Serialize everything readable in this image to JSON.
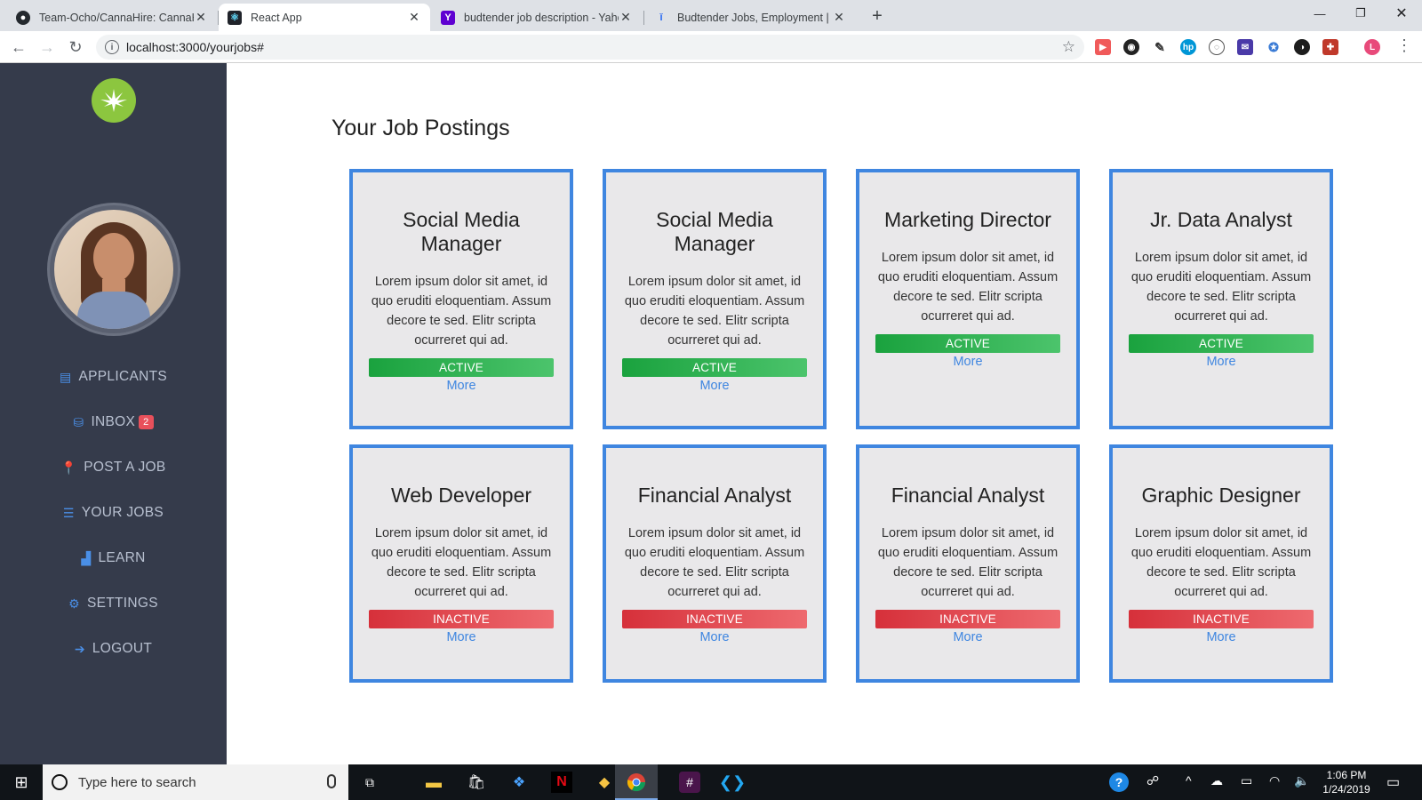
{
  "browser": {
    "tabs": [
      {
        "title": "Team-Ocho/CannaHire: CannaHire",
        "icon": "github-icon",
        "active": false
      },
      {
        "title": "React App",
        "icon": "react-icon",
        "active": true
      },
      {
        "title": "budtender job description - Yahoo",
        "icon": "yahoo-icon",
        "active": false
      },
      {
        "title": "Budtender Jobs, Employment | Indeed",
        "icon": "indeed-icon",
        "active": false
      }
    ],
    "url": "localhost:3000/yourjobs#"
  },
  "sidebar": {
    "nav": [
      {
        "label": "APPLICANTS",
        "icon": "applicants-icon"
      },
      {
        "label": "INBOX",
        "icon": "inbox-icon",
        "badge": "2"
      },
      {
        "label": "POST A JOB",
        "icon": "pin-icon"
      },
      {
        "label": "YOUR JOBS",
        "icon": "list-icon"
      },
      {
        "label": "LEARN",
        "icon": "chart-icon"
      },
      {
        "label": "SETTINGS",
        "icon": "gear-icon"
      },
      {
        "label": "LOGOUT",
        "icon": "logout-icon"
      }
    ]
  },
  "main": {
    "title": "Your Job Postings",
    "jobs": [
      {
        "title": "Social Media Manager",
        "description": "Lorem ipsum dolor sit amet, id quo eruditi eloquentiam. Assum decore te sed. Elitr scripta ocurreret qui ad.",
        "status": "ACTIVE",
        "more": "More"
      },
      {
        "title": "Social Media Manager",
        "description": "Lorem ipsum dolor sit amet, id quo eruditi eloquentiam. Assum decore te sed. Elitr scripta ocurreret qui ad.",
        "status": "ACTIVE",
        "more": "More"
      },
      {
        "title": "Marketing Director",
        "description": "Lorem ipsum dolor sit amet, id quo eruditi eloquentiam. Assum decore te sed. Elitr scripta ocurreret qui ad.",
        "status": "ACTIVE",
        "more": "More"
      },
      {
        "title": "Jr. Data Analyst",
        "description": "Lorem ipsum dolor sit amet, id quo eruditi eloquentiam. Assum decore te sed. Elitr scripta ocurreret qui ad.",
        "status": "ACTIVE",
        "more": "More"
      },
      {
        "title": "Web Developer",
        "description": "Lorem ipsum dolor sit amet, id quo eruditi eloquentiam. Assum decore te sed. Elitr scripta ocurreret qui ad.",
        "status": "INACTIVE",
        "more": "More"
      },
      {
        "title": "Financial Analyst",
        "description": "Lorem ipsum dolor sit amet, id quo eruditi eloquentiam. Assum decore te sed. Elitr scripta ocurreret qui ad.",
        "status": "INACTIVE",
        "more": "More"
      },
      {
        "title": "Financial Analyst",
        "description": "Lorem ipsum dolor sit amet, id quo eruditi eloquentiam. Assum decore te sed. Elitr scripta ocurreret qui ad.",
        "status": "INACTIVE",
        "more": "More"
      },
      {
        "title": "Graphic Designer",
        "description": "Lorem ipsum dolor sit amet, id quo eruditi eloquentiam. Assum decore te sed. Elitr scripta ocurreret qui ad.",
        "status": "INACTIVE",
        "more": "More"
      }
    ]
  },
  "taskbar": {
    "search_placeholder": "Type here to search",
    "time": "1:06 PM",
    "date": "1/24/2019"
  },
  "colors": {
    "sidebar_bg": "#353b4b",
    "card_border": "#3f86e0",
    "active_status": "#1aa23e",
    "inactive_status": "#d6303a",
    "link": "#3f86e0"
  }
}
